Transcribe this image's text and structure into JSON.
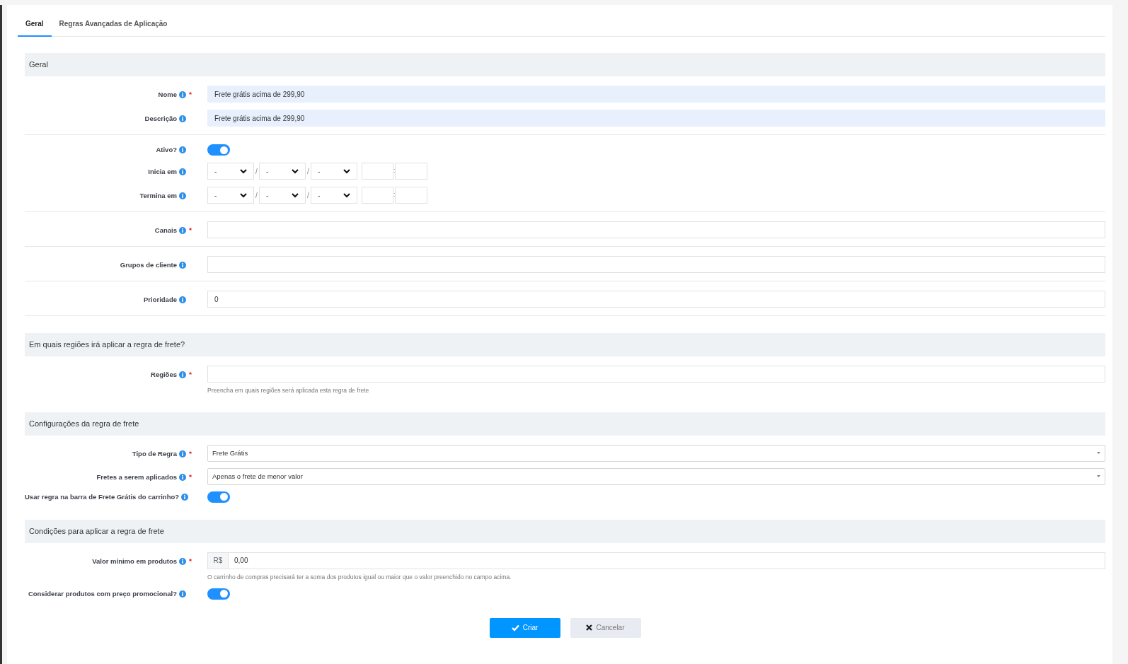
{
  "tabs": [
    {
      "label": "Geral",
      "selected": true
    },
    {
      "label": "Regras Avançadas de Aplicação",
      "selected": false
    }
  ],
  "sections": [
    {
      "title": "Geral",
      "groups": [
        [
          {
            "kind": "text",
            "label": "Nome",
            "required": true,
            "value": "Frete grátis acima de 299,90",
            "autofilled": true
          },
          {
            "kind": "text",
            "label": "Descrição",
            "required": false,
            "value": "Frete grátis acima de 299,90",
            "autofilled": true
          }
        ],
        [
          {
            "kind": "toggle",
            "label": "Ativo?",
            "required": false,
            "on": true
          },
          {
            "kind": "datetime",
            "label": "Inicia em",
            "required": false,
            "date_parts": [
              "-",
              "-",
              "-"
            ],
            "date_separators": [
              "/",
              "/"
            ],
            "time_separator": ":"
          },
          {
            "kind": "datetime",
            "label": "Termina em",
            "required": false,
            "date_parts": [
              "-",
              "-",
              "-"
            ],
            "date_separators": [
              "/",
              "/"
            ],
            "time_separator": ":"
          }
        ],
        [
          {
            "kind": "text",
            "label": "Canais",
            "required": true,
            "autofilled": false
          }
        ],
        [
          {
            "kind": "text",
            "label": "Grupos de cliente",
            "required": false,
            "autofilled": false
          }
        ],
        [
          {
            "kind": "text",
            "label": "Prioridade",
            "required": false,
            "value": "0",
            "autofilled": false
          }
        ]
      ]
    },
    {
      "title": "Em quais regiões irá aplicar a regra de frete?",
      "groups": [
        [
          {
            "kind": "text",
            "label": "Regiões",
            "required": true,
            "autofilled": false,
            "help": "Preencha em quais regiões será aplicada esta regra de frete"
          }
        ]
      ]
    },
    {
      "title": "Configurações da regra de frete",
      "groups": [
        [
          {
            "kind": "select",
            "label": "Tipo de Regra",
            "required": true,
            "value": "Frete Grátis"
          },
          {
            "kind": "select",
            "label": "Fretes a serem aplicados",
            "required": true,
            "value": "Apenas o frete de menor valor"
          },
          {
            "kind": "toggle",
            "label": "Usar regra na barra de Frete Grátis do carrinho?",
            "required": false,
            "on": true
          }
        ]
      ]
    },
    {
      "title": "Condições para aplicar a regra de frete",
      "groups": [
        [
          {
            "kind": "money",
            "label": "Valor mínimo em produtos",
            "required": true,
            "prefix": "R$",
            "value": "0,00",
            "help": "O carrinho de compras precisará ter a soma dos produtos igual ou maior que o valor preenchido no campo acima."
          },
          {
            "kind": "toggle",
            "label": "Considerar produtos com preço promocional?",
            "required": false,
            "on": true
          }
        ]
      ]
    }
  ],
  "buttons": [
    {
      "kind": "primary",
      "label": "Criar"
    },
    {
      "kind": "secondary",
      "label": "Cancelar"
    }
  ]
}
